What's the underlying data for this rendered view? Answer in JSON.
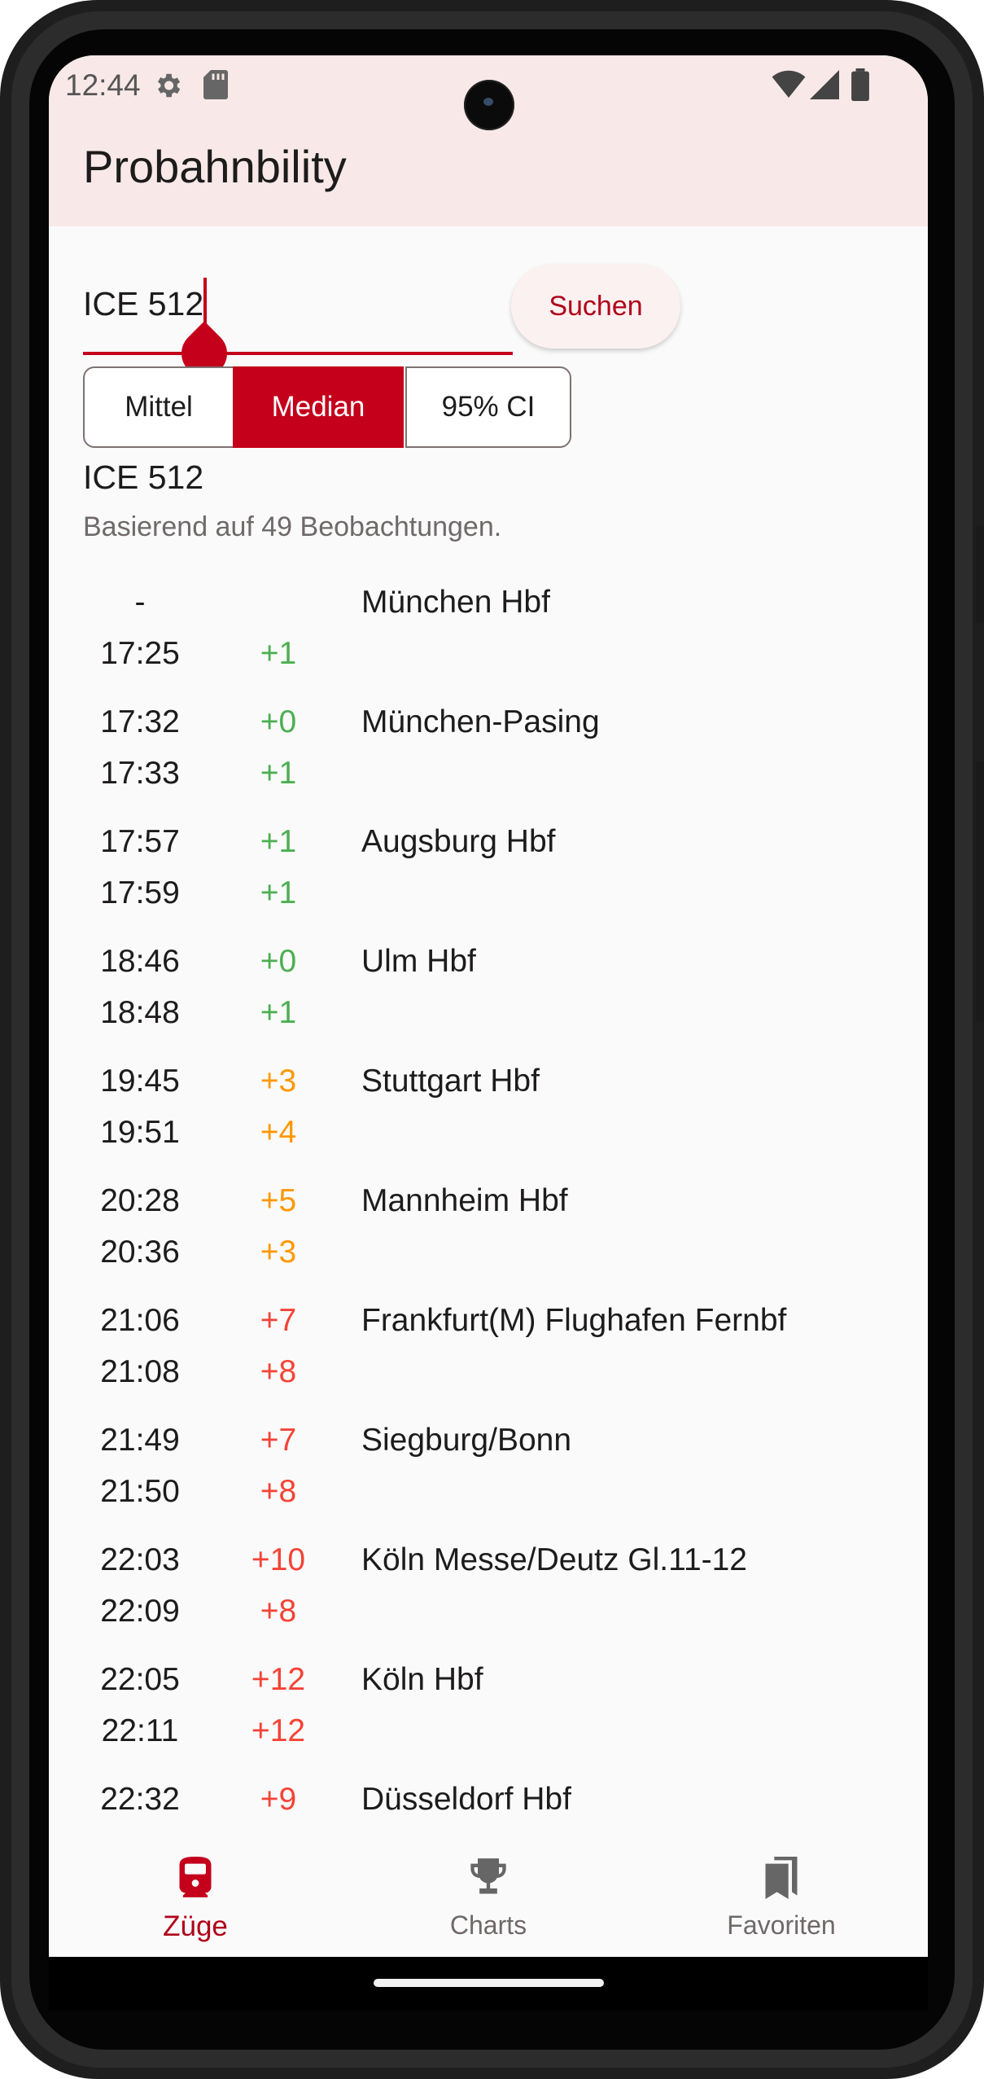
{
  "status": {
    "time": "12:44"
  },
  "app": {
    "title": "Probahnbility"
  },
  "search": {
    "value": "ICE 512",
    "button_label": "Suchen"
  },
  "modes": {
    "options": [
      "Mittel",
      "Median",
      "95% CI"
    ],
    "selected": "Median"
  },
  "train": {
    "title": "ICE 512",
    "subtitle": "Basierend auf 49 Beobachtungen."
  },
  "colors": {
    "accent": "#c4001b",
    "ok": "#4caf50",
    "warn": "#ff9800",
    "late": "#f44336"
  },
  "stops": [
    {
      "name": "München Hbf",
      "arr": "-",
      "arr_delay": "",
      "dep": "17:25",
      "dep_delay": "+1",
      "arr_color": "ok",
      "dep_color": "ok"
    },
    {
      "name": "München-Pasing",
      "arr": "17:32",
      "arr_delay": "+0",
      "dep": "17:33",
      "dep_delay": "+1",
      "arr_color": "ok",
      "dep_color": "ok"
    },
    {
      "name": "Augsburg Hbf",
      "arr": "17:57",
      "arr_delay": "+1",
      "dep": "17:59",
      "dep_delay": "+1",
      "arr_color": "ok",
      "dep_color": "ok"
    },
    {
      "name": "Ulm Hbf",
      "arr": "18:46",
      "arr_delay": "+0",
      "dep": "18:48",
      "dep_delay": "+1",
      "arr_color": "ok",
      "dep_color": "ok"
    },
    {
      "name": "Stuttgart Hbf",
      "arr": "19:45",
      "arr_delay": "+3",
      "dep": "19:51",
      "dep_delay": "+4",
      "arr_color": "warn",
      "dep_color": "warn"
    },
    {
      "name": "Mannheim Hbf",
      "arr": "20:28",
      "arr_delay": "+5",
      "dep": "20:36",
      "dep_delay": "+3",
      "arr_color": "warn",
      "dep_color": "warn"
    },
    {
      "name": "Frankfurt(M) Flughafen Fernbf",
      "arr": "21:06",
      "arr_delay": "+7",
      "dep": "21:08",
      "dep_delay": "+8",
      "arr_color": "late",
      "dep_color": "late"
    },
    {
      "name": "Siegburg/Bonn",
      "arr": "21:49",
      "arr_delay": "+7",
      "dep": "21:50",
      "dep_delay": "+8",
      "arr_color": "late",
      "dep_color": "late"
    },
    {
      "name": "Köln Messe/Deutz Gl.11-12",
      "arr": "22:03",
      "arr_delay": "+10",
      "dep": "22:09",
      "dep_delay": "+8",
      "arr_color": "late",
      "dep_color": "late"
    },
    {
      "name": "Köln Hbf",
      "arr": "22:05",
      "arr_delay": "+12",
      "dep": "22:11",
      "dep_delay": "+12",
      "arr_color": "late",
      "dep_color": "late"
    },
    {
      "name": "Düsseldorf Hbf",
      "arr": "22:32",
      "arr_delay": "+9",
      "dep": "",
      "dep_delay": "",
      "arr_color": "late",
      "dep_color": "late"
    }
  ],
  "nav": [
    {
      "label": "Züge",
      "icon": "train-icon",
      "active": true
    },
    {
      "label": "Charts",
      "icon": "trophy-icon",
      "active": false
    },
    {
      "label": "Favoriten",
      "icon": "bookmarks-icon",
      "active": false
    }
  ]
}
